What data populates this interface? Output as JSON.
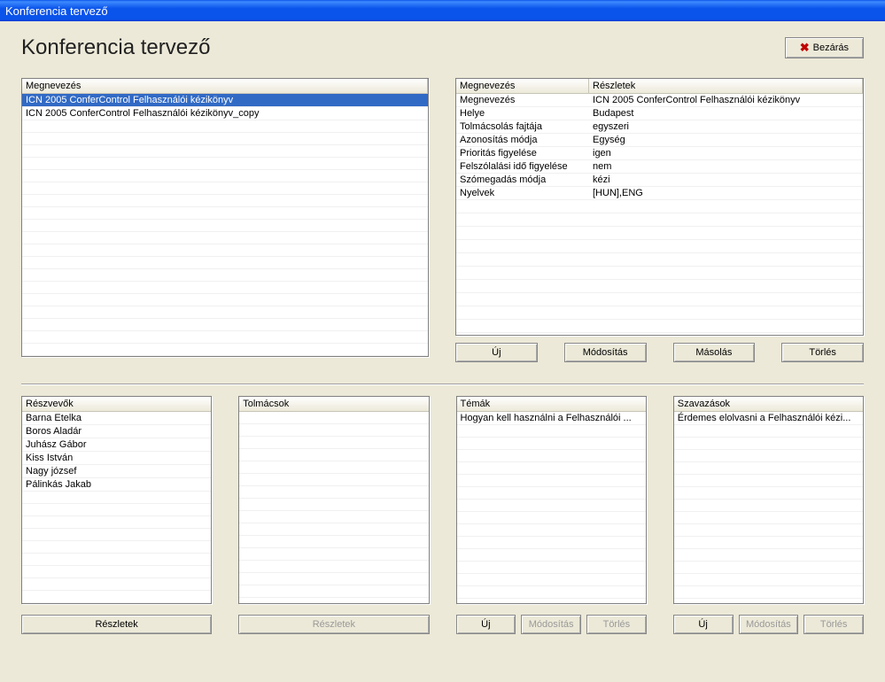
{
  "window": {
    "title": "Konferencia tervező"
  },
  "pageTitle": "Konferencia tervező",
  "closeButton": "Bezárás",
  "leftList": {
    "header": "Megnevezés",
    "items": [
      "ICN 2005 ConferControl Felhasználói kézikönyv",
      "ICN 2005 ConferControl Felhasználói kézikönyv_copy"
    ],
    "selectedIndex": 0
  },
  "details": {
    "headerLabel": "Megnevezés",
    "headerValue": "Részletek",
    "rows": [
      {
        "label": "Megnevezés",
        "value": "ICN 2005 ConferControl Felhasználói kézikönyv"
      },
      {
        "label": "Helye",
        "value": "Budapest"
      },
      {
        "label": "Tolmácsolás fajtája",
        "value": "egyszeri"
      },
      {
        "label": "Azonosítás módja",
        "value": "Egység"
      },
      {
        "label": "Prioritás figyelése",
        "value": "igen"
      },
      {
        "label": "Felszólalási idő figyelése",
        "value": "nem"
      },
      {
        "label": "Szómegadás módja",
        "value": "kézi"
      },
      {
        "label": "Nyelvek",
        "value": "[HUN],ENG"
      }
    ]
  },
  "detailButtons": {
    "new": "Új",
    "modify": "Módosítás",
    "copy": "Másolás",
    "delete": "Törlés"
  },
  "bottom": {
    "participants": {
      "header": "Részvevők",
      "items": [
        "Barna Etelka",
        "Boros Aladár",
        "Juhász Gábor",
        "Kiss István",
        "Nagy józsef",
        "Pálinkás Jakab"
      ],
      "btnDetails": "Részletek"
    },
    "interpreters": {
      "header": "Tolmácsok",
      "items": [],
      "btnDetails": "Részletek"
    },
    "topics": {
      "header": "Témák",
      "items": [
        "Hogyan kell használni a Felhasználói ..."
      ],
      "btnNew": "Új",
      "btnModify": "Módosítás",
      "btnDelete": "Törlés"
    },
    "votes": {
      "header": "Szavazások",
      "items": [
        "Érdemes elolvasni a Felhasználói kézi..."
      ],
      "btnNew": "Új",
      "btnModify": "Módosítás",
      "btnDelete": "Törlés"
    }
  }
}
